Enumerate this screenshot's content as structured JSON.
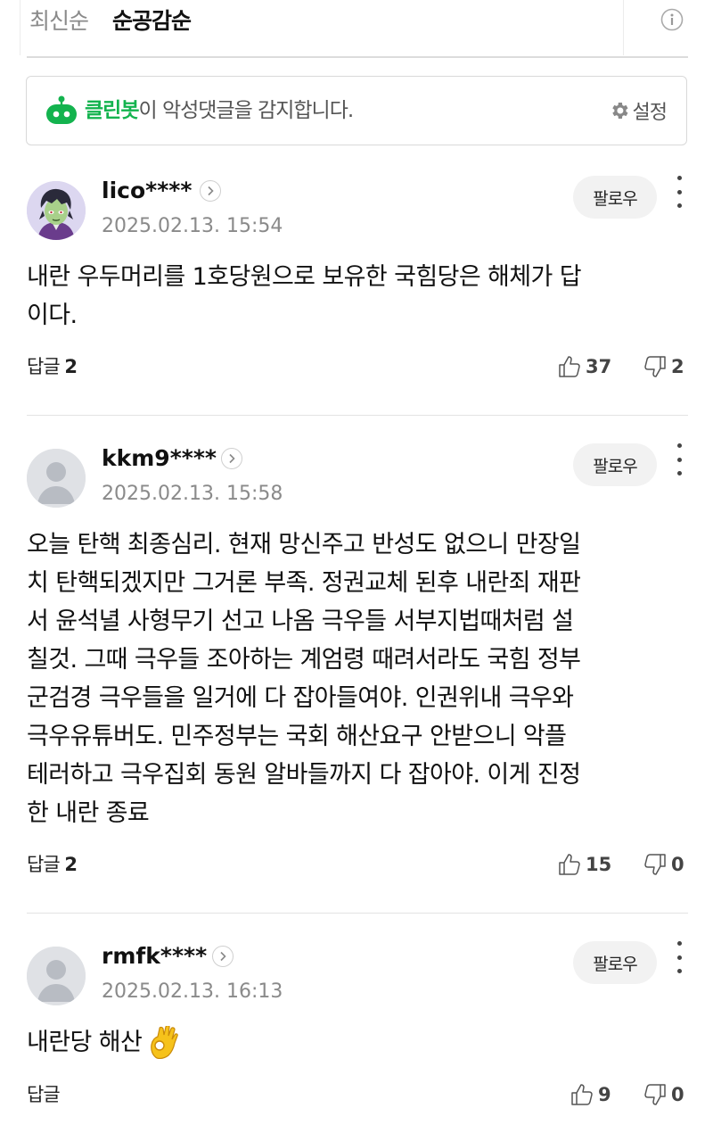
{
  "sort": {
    "recent_label": "최신순",
    "popular_label": "순공감순",
    "info_icon": "info-icon"
  },
  "cleanbot": {
    "name": "클린봇",
    "message": "이 악성댓글을 감지합니다.",
    "settings_label": "설정",
    "brand_color": "#13b34e"
  },
  "comments": [
    {
      "username": "lico****",
      "timestamp": "2025.02.13. 15:54",
      "follow_label": "팔로우",
      "text": "내란 우두머리를 1호당원으로 보유한 국힘당은 해체가 답\n이다.",
      "reply_label": "답글",
      "reply_count": "2",
      "likes": "37",
      "dislikes": "2",
      "avatar": "cartoon-avatar"
    },
    {
      "username": "kkm9****",
      "timestamp": "2025.02.13. 15:58",
      "follow_label": "팔로우",
      "text": "오늘 탄핵 최종심리. 현재 망신주고 반성도 없으니 만장일\n치 탄핵되겠지만 그거론 부족. 정권교체 된후 내란죄 재판\n서 윤석녈 사형무기 선고 나옴 극우들 서부지법때처럼 설\n칠것. 그때 극우들 조아하는 계엄령 때려서라도 국힘 정부\n군검경 극우들을 일거에 다 잡아들여야. 인권위내 극우와\n극우유튜버도. 민주정부는 국회 해산요구 안받으니 악플\n테러하고 극우집회 동원 알바들까지 다 잡아야. 이게 진정\n한 내란 종료",
      "reply_label": "답글",
      "reply_count": "2",
      "likes": "15",
      "dislikes": "0",
      "avatar": "default-avatar"
    },
    {
      "username": "rmfk****",
      "timestamp": "2025.02.13. 16:13",
      "follow_label": "팔로우",
      "text": "내란당 해산",
      "emoji": "ok-hand-emoji",
      "reply_label": "답글",
      "reply_count": "",
      "likes": "9",
      "dislikes": "0",
      "avatar": "default-avatar"
    }
  ]
}
